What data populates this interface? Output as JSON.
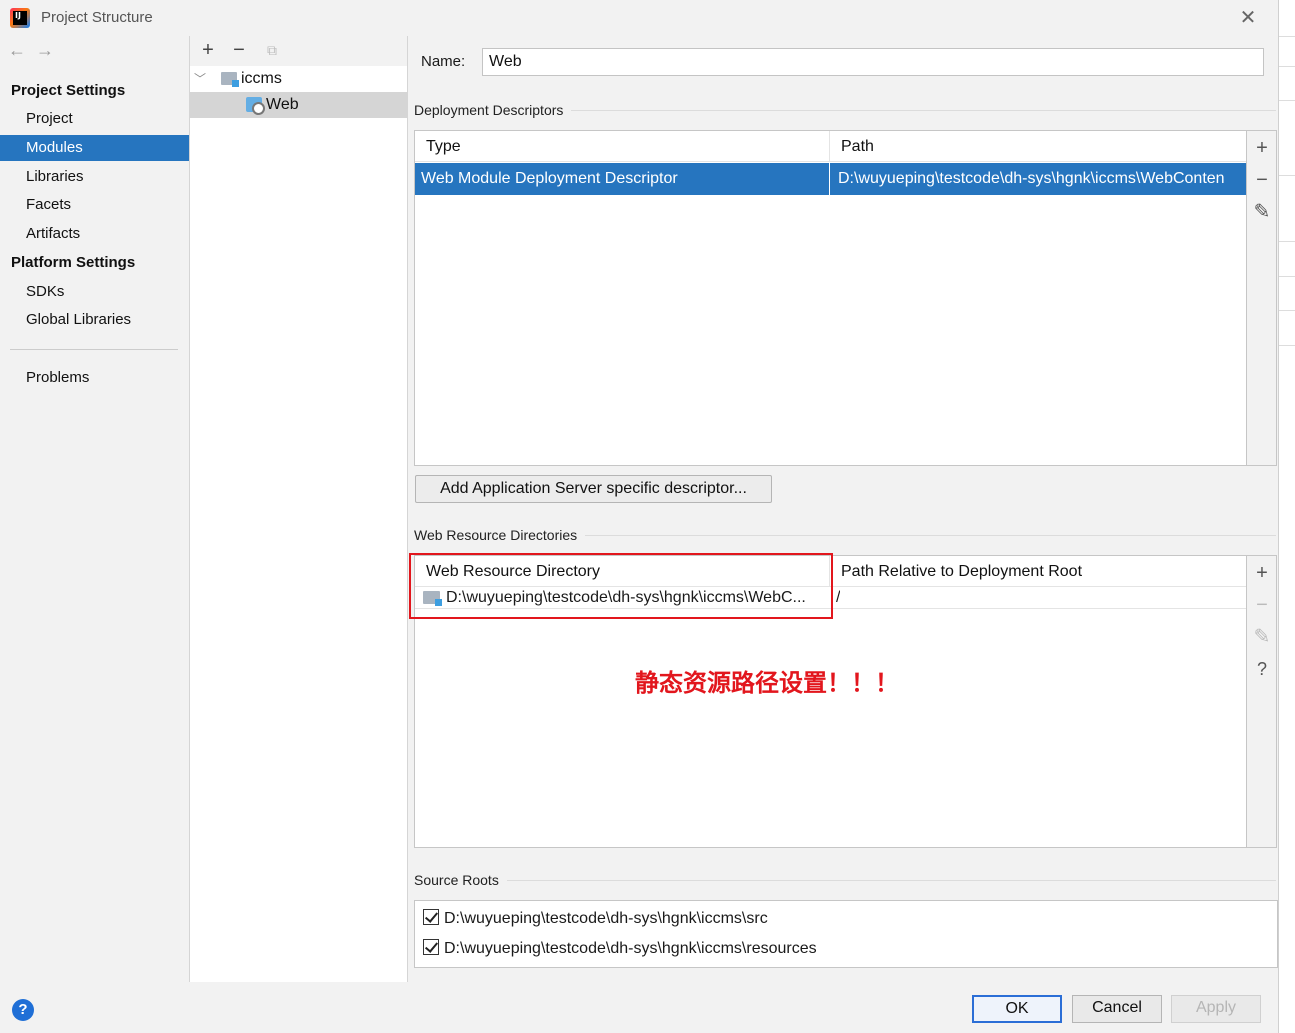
{
  "window": {
    "title": "Project Structure"
  },
  "nav": {
    "back": "←",
    "forward": "→",
    "project_settings": "Project Settings",
    "project_items": [
      "Project",
      "Modules",
      "Libraries",
      "Facets",
      "Artifacts"
    ],
    "platform_settings": "Platform Settings",
    "platform_items": [
      "SDKs",
      "Global Libraries"
    ],
    "problems": "Problems",
    "selected": "Modules"
  },
  "tree": {
    "toolbar": {
      "add": "+",
      "remove": "−",
      "copy": "⧉"
    },
    "root": "iccms",
    "child": "Web"
  },
  "form": {
    "name_label": "Name:",
    "name_value": "Web"
  },
  "deployment": {
    "title": "Deployment Descriptors",
    "columns": [
      "Type",
      "Path"
    ],
    "rows": [
      {
        "type": "Web Module Deployment Descriptor",
        "path": "D:\\wuyueping\\testcode\\dh-sys\\hgnk\\iccms\\WebConten"
      }
    ],
    "add_server_button": "Add Application Server specific descriptor..."
  },
  "web_resources": {
    "title": "Web Resource Directories",
    "columns": [
      "Web Resource Directory",
      "Path Relative to Deployment Root"
    ],
    "rows": [
      {
        "directory": "D:\\wuyueping\\testcode\\dh-sys\\hgnk\\iccms\\WebC...",
        "relative": "/"
      }
    ],
    "annotation": "静态资源路径设置！！！"
  },
  "source_roots": {
    "title": "Source Roots",
    "items": [
      "D:\\wuyueping\\testcode\\dh-sys\\hgnk\\iccms\\src",
      "D:\\wuyueping\\testcode\\dh-sys\\hgnk\\iccms\\resources"
    ]
  },
  "side_tools": {
    "add": "+",
    "remove": "−",
    "edit": "✎",
    "help": "?"
  },
  "buttons": {
    "ok": "OK",
    "cancel": "Cancel",
    "apply": "Apply",
    "help": "?"
  },
  "colors": {
    "selection": "#2675bf",
    "annotation": "#e2161d",
    "ok_border": "#2b6ed6"
  }
}
